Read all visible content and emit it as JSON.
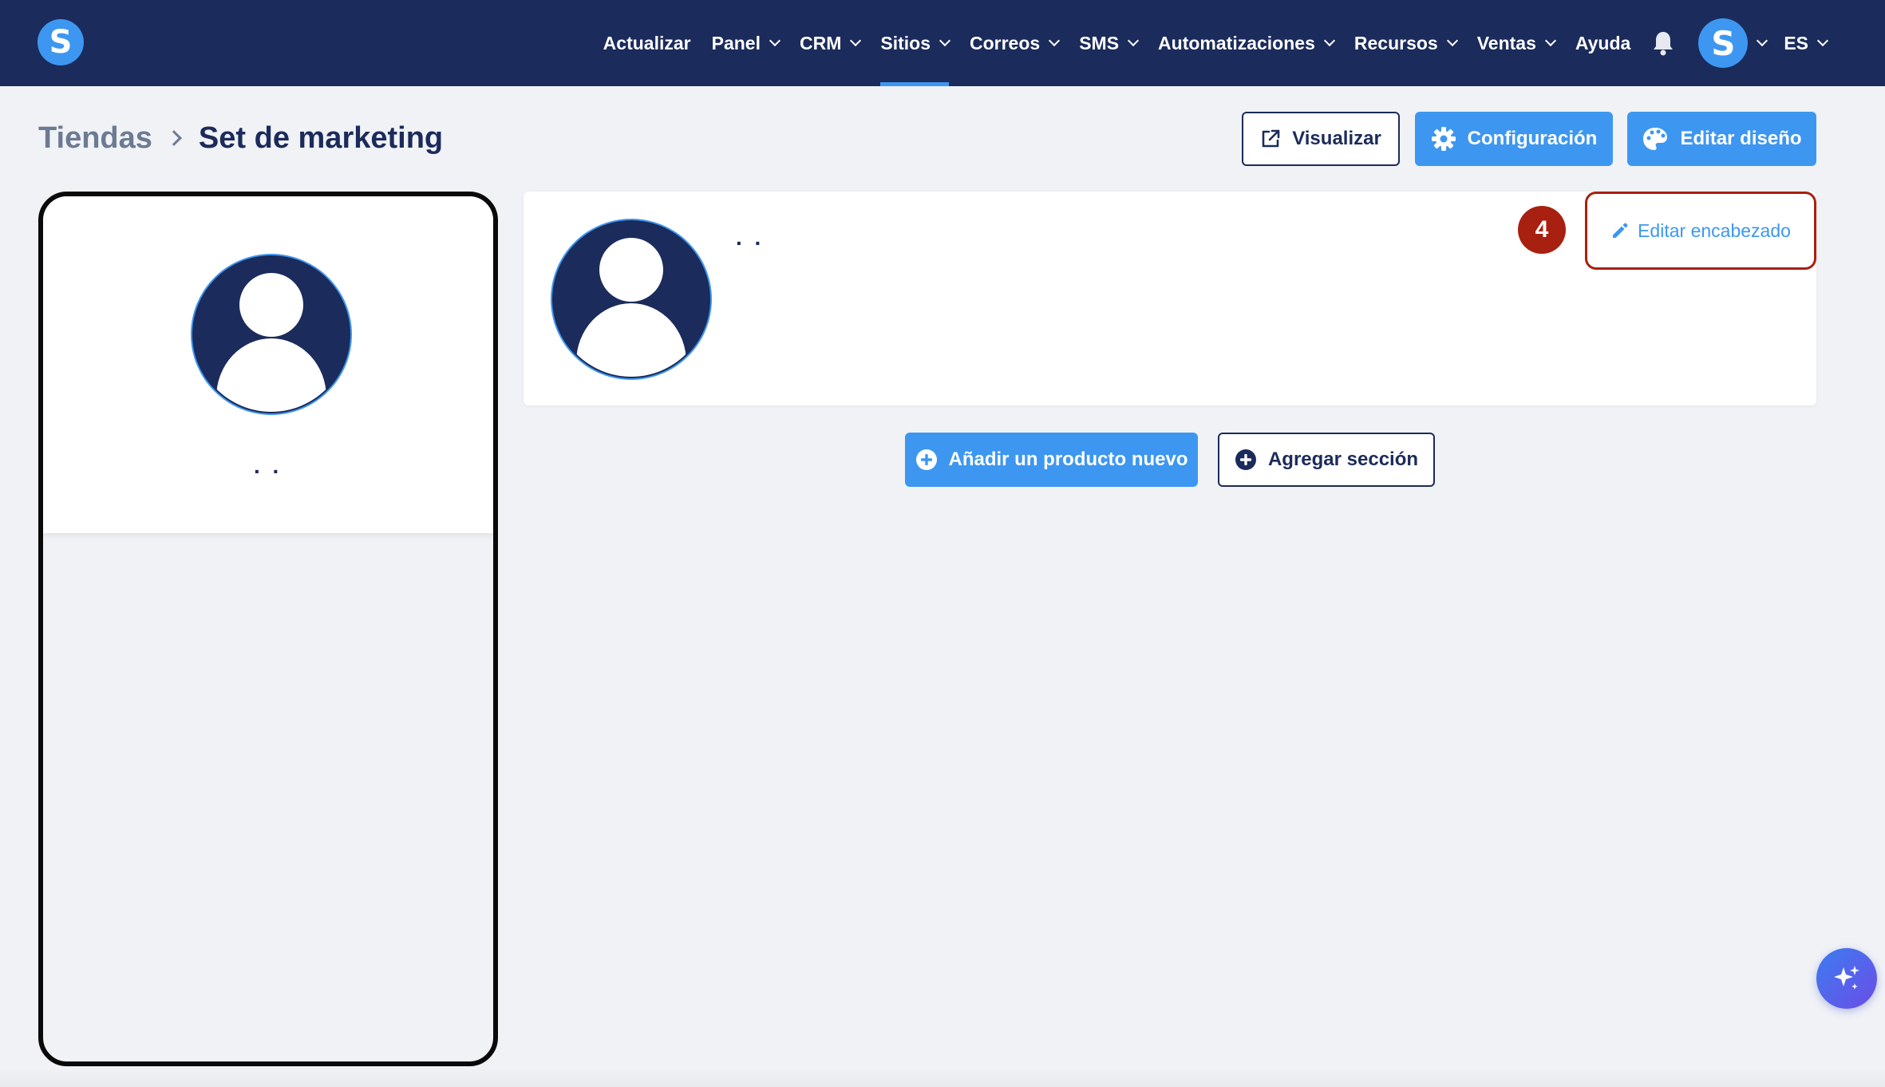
{
  "app": {
    "logo_letter": "S"
  },
  "nav": {
    "items": [
      {
        "label": "Actualizar",
        "has_dropdown": false,
        "active": false
      },
      {
        "label": "Panel",
        "has_dropdown": true,
        "active": false
      },
      {
        "label": "CRM",
        "has_dropdown": true,
        "active": false
      },
      {
        "label": "Sitios",
        "has_dropdown": true,
        "active": true
      },
      {
        "label": "Correos",
        "has_dropdown": true,
        "active": false
      },
      {
        "label": "SMS",
        "has_dropdown": true,
        "active": false
      },
      {
        "label": "Automatizaciones",
        "has_dropdown": true,
        "active": false
      },
      {
        "label": "Recursos",
        "has_dropdown": true,
        "active": false
      },
      {
        "label": "Ventas",
        "has_dropdown": true,
        "active": false
      },
      {
        "label": "Ayuda",
        "has_dropdown": false,
        "active": false
      }
    ],
    "bell_icon": "bell-icon",
    "user_avatar_letter": "S",
    "language": "ES"
  },
  "breadcrumb": {
    "parent": "Tiendas",
    "current": "Set de marketing"
  },
  "actions": {
    "preview_label": "Visualizar",
    "settings_label": "Configuración",
    "edit_design_label": "Editar diseño"
  },
  "phone_preview": {
    "store_name_placeholder": ". ."
  },
  "store_header": {
    "name_placeholder": ". .",
    "edit_header_label": "Editar encabezado",
    "step_number": "4"
  },
  "content_actions": {
    "add_product_label": "Añadir un producto nuevo",
    "add_section_label": "Agregar sección"
  },
  "colors": {
    "nav_bg": "#1b2b5b",
    "primary": "#3d97f0",
    "highlight": "#a8200f",
    "page_bg": "#f0f2f6"
  }
}
